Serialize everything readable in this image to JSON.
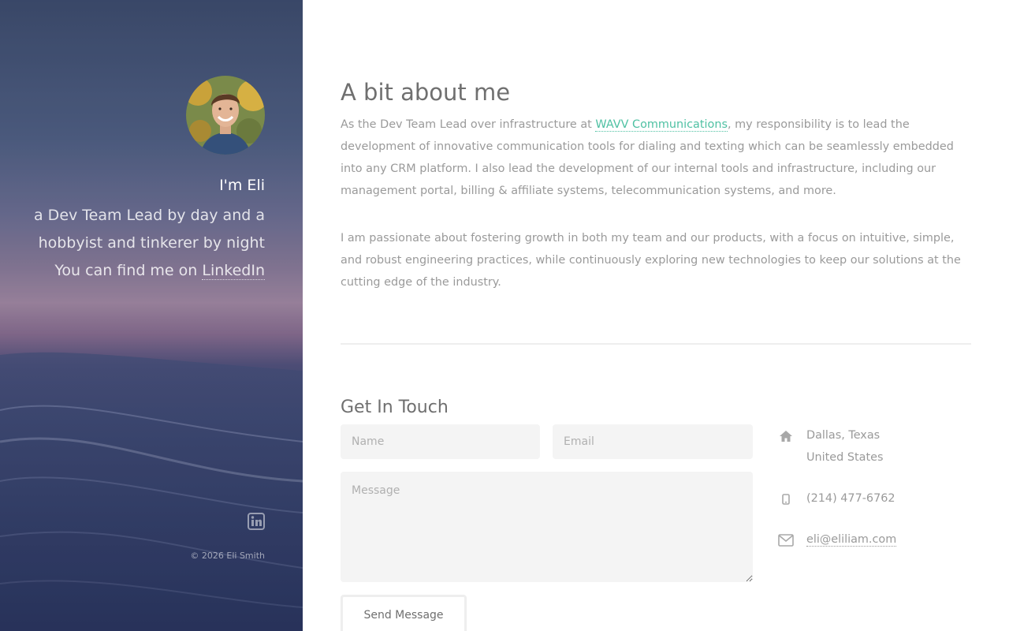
{
  "sidebar": {
    "name": "I'm Eli",
    "tagline": "a Dev Team Lead by day and a hobbyist and tinkerer by night",
    "find_prefix": "You can find me on ",
    "find_link": "LinkedIn",
    "copyright": "© 2026 Eli Smith",
    "icons": {
      "avatar": "avatar-photo",
      "social": "linkedin-icon"
    }
  },
  "about": {
    "title": "A bit about me",
    "p1_before": "As the Dev Team Lead over infrastructure at ",
    "p1_link": "WAVV Communications",
    "p1_after": ", my responsibility is to lead the development of innovative communication tools for dialing and texting which can be seamlessly embedded into any CRM platform. I also lead the development of our internal tools and infrastructure, including our management portal, billing & affiliate systems, telecommunication systems, and more.",
    "p2": "I am passionate about fostering growth in both my team and our products, with a focus on intuitive, simple, and robust engineering practices, while continuously exploring new technologies to keep our solutions at the cutting edge of the industry."
  },
  "contact": {
    "title": "Get In Touch",
    "name_placeholder": "Name",
    "email_placeholder": "Email",
    "message_placeholder": "Message",
    "send_label": "Send Message",
    "address_line1": "Dallas, Texas",
    "address_line2": "United States",
    "phone": "(214) 477-6762",
    "email": "eli@eliliam.com",
    "icons": {
      "address": "home-icon",
      "phone": "mobile-icon",
      "email": "envelope-icon"
    }
  },
  "colors": {
    "accent_link": "#4fc1a3",
    "heading": "#6f6f6f",
    "body_text": "#9a9a9a",
    "field_bg": "#f4f4f4"
  }
}
